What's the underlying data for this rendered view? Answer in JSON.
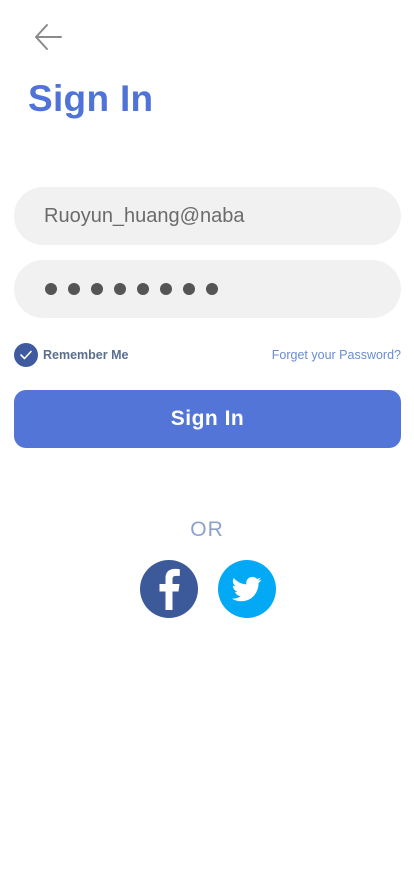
{
  "header": {
    "back_icon": "arrow-left-icon",
    "title": "Sign In"
  },
  "form": {
    "email_value": "Ruoyun_huang@naba",
    "password_mask_count": 8,
    "remember_label": "Remember Me",
    "remember_checked": true,
    "forgot_label": "Forget your Password?",
    "submit_label": "Sign In"
  },
  "social": {
    "or_label": "OR",
    "facebook_icon": "facebook-icon",
    "twitter_icon": "twitter-icon"
  },
  "colors": {
    "accent": "#5275d7",
    "title": "#4f73d6",
    "field_bg": "#f1f1f1",
    "facebook": "#3c5a99",
    "twitter": "#03a9f4"
  }
}
